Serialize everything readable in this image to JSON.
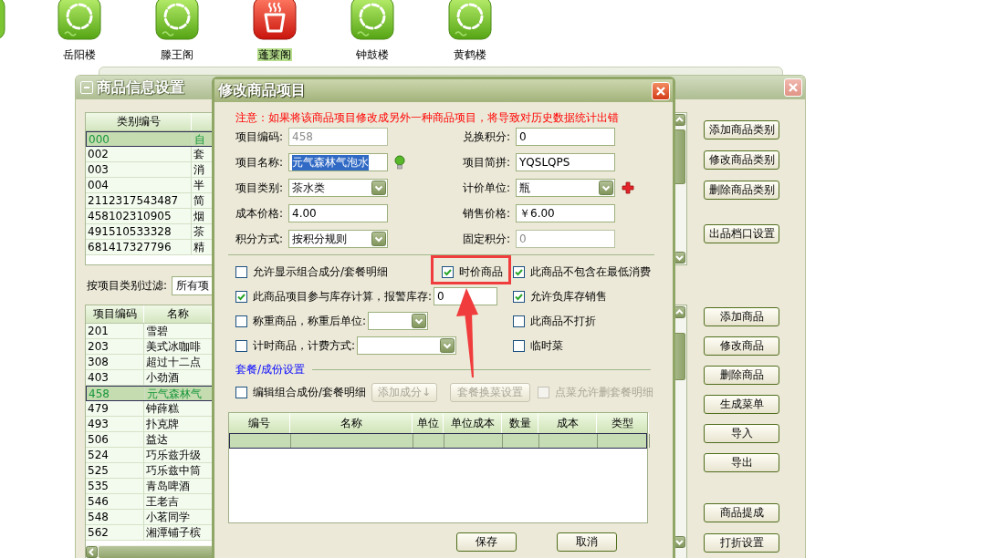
{
  "launcher": [
    {
      "label": "岳阳楼",
      "kind": "swirl",
      "selected": false
    },
    {
      "label": "滕王阁",
      "kind": "swirl",
      "selected": false
    },
    {
      "label": "蓬莱阁",
      "kind": "cup",
      "selected": true
    },
    {
      "label": "钟鼓楼",
      "kind": "swirl",
      "selected": false
    },
    {
      "label": "黄鹤楼",
      "kind": "swirl",
      "selected": false
    }
  ],
  "main_window": {
    "title": "商品信息设置",
    "category_table": {
      "columns": [
        "类别编号"
      ],
      "rows": [
        {
          "cells": [
            "000",
            "自"
          ],
          "selected": true
        },
        {
          "cells": [
            "002",
            "套"
          ],
          "selected": false
        },
        {
          "cells": [
            "003",
            "消"
          ],
          "selected": false
        },
        {
          "cells": [
            "004",
            "半"
          ],
          "selected": false
        },
        {
          "cells": [
            "2112317543487",
            "简"
          ],
          "selected": false
        },
        {
          "cells": [
            "458102310905",
            "烟"
          ],
          "selected": false
        },
        {
          "cells": [
            "491510533328",
            "茶"
          ],
          "selected": false
        },
        {
          "cells": [
            "681417327796",
            "精"
          ],
          "selected": false
        }
      ]
    },
    "filter": {
      "label": "按项目类别过滤:",
      "value": "所有项"
    },
    "item_table": {
      "columns": [
        "项目编码",
        "名称"
      ],
      "rows": [
        {
          "cells": [
            "201",
            "雪碧"
          ],
          "selected": false
        },
        {
          "cells": [
            "203",
            "美式冰咖啡"
          ],
          "selected": false
        },
        {
          "cells": [
            "308",
            "超过十二点"
          ],
          "selected": false
        },
        {
          "cells": [
            "403",
            "小劲酒"
          ],
          "selected": false
        },
        {
          "cells": [
            "458",
            "元气森林气"
          ],
          "selected": true
        },
        {
          "cells": [
            "479",
            "钟薛糕"
          ],
          "selected": false
        },
        {
          "cells": [
            "493",
            "扑克牌"
          ],
          "selected": false
        },
        {
          "cells": [
            "506",
            "益达"
          ],
          "selected": false
        },
        {
          "cells": [
            "524",
            "巧乐兹升级"
          ],
          "selected": false
        },
        {
          "cells": [
            "525",
            "巧乐兹中筒"
          ],
          "selected": false
        },
        {
          "cells": [
            "535",
            "青岛啤酒"
          ],
          "selected": false
        },
        {
          "cells": [
            "546",
            "王老吉"
          ],
          "selected": false
        },
        {
          "cells": [
            "548",
            "小茗同学"
          ],
          "selected": false
        },
        {
          "cells": [
            "562",
            "湘潭铺子槟"
          ],
          "selected": false
        }
      ]
    },
    "button_groups": [
      [
        "添加商品类别",
        "修改商品类别",
        "删除商品类别"
      ],
      [
        "出品档口设置"
      ],
      [
        "添加商品",
        "修改商品",
        "删除商品",
        "生成菜单",
        "导入",
        "导出"
      ],
      [
        "商品提成",
        "打折设置"
      ]
    ]
  },
  "dialog": {
    "title": "修改商品项目",
    "notice": "注意：如果将该商品项目修改成另外一种商品项目，将导致对历史数据统计出错",
    "fields": [
      {
        "label": "项目编码:",
        "value": "458",
        "kind": "text",
        "disabled": true,
        "highlighted": false,
        "bulb": false,
        "add_button": false
      },
      {
        "label": "兑换积分:",
        "value": "0",
        "kind": "text",
        "disabled": false,
        "highlighted": false,
        "bulb": false,
        "add_button": false
      },
      {
        "label": "项目名称:",
        "value": "元气森林气泡水",
        "kind": "text",
        "disabled": false,
        "highlighted": true,
        "bulb": true,
        "add_button": false
      },
      {
        "label": "项目简拼:",
        "value": "YQSLQPS",
        "kind": "text",
        "disabled": false,
        "highlighted": false,
        "bulb": false,
        "add_button": false
      },
      {
        "label": "项目类别:",
        "value": "茶水类",
        "kind": "combo",
        "disabled": false,
        "highlighted": false,
        "bulb": false,
        "add_button": false
      },
      {
        "label": "计价单位:",
        "value": "瓶",
        "kind": "combo",
        "disabled": false,
        "highlighted": false,
        "bulb": false,
        "add_button": true
      },
      {
        "label": "成本价格:",
        "value": "4.00",
        "kind": "text",
        "disabled": false,
        "highlighted": false,
        "bulb": false,
        "add_button": false
      },
      {
        "label": "销售价格:",
        "value": "￥6.00",
        "kind": "text",
        "disabled": false,
        "highlighted": false,
        "bulb": false,
        "add_button": false
      },
      {
        "label": "积分方式:",
        "value": "按积分规则",
        "kind": "combo",
        "disabled": false,
        "highlighted": false,
        "bulb": false,
        "add_button": false
      },
      {
        "label": "固定积分:",
        "value": "0",
        "kind": "text",
        "disabled": true,
        "highlighted": false,
        "bulb": false,
        "add_button": false
      }
    ],
    "options": [
      {
        "label": "允许显示组合成分/套餐明细",
        "kind": "check",
        "checked": false
      },
      {
        "label": "时价商品",
        "kind": "check",
        "checked": true
      },
      {
        "label": "此商品不包含在最低消费",
        "kind": "check",
        "checked": true
      },
      {
        "label": "此商品项目参与库存计算，报警库存:",
        "kind": "checkfield",
        "checked": true,
        "value": "0"
      },
      {
        "label": "允许负库存销售",
        "kind": "check",
        "checked": true
      },
      {
        "label": "称重商品，称重后单位:",
        "kind": "checkcombo",
        "checked": false
      },
      {
        "label": "此商品不打折",
        "kind": "check",
        "checked": false
      },
      {
        "label": "计时商品，计费方式:",
        "kind": "checkcombo",
        "checked": false
      },
      {
        "label": "临时菜",
        "kind": "check",
        "checked": false
      }
    ],
    "package": {
      "title": "套餐/成份设置",
      "edit_option": {
        "label": "编辑组合成份/套餐明细",
        "checked": false
      },
      "buttons": [
        {
          "label": "添加成分↓",
          "disabled": true
        },
        {
          "label": "套餐换菜设置",
          "disabled": true
        }
      ],
      "delete_option": {
        "label": "点菜允许删套餐明细",
        "checked": false,
        "disabled": true
      },
      "table": {
        "columns": [
          "编号",
          "名称",
          "单位",
          "单位成本",
          "数量",
          "成本",
          "类型"
        ],
        "rows": [
          {
            "selected": true
          }
        ]
      }
    },
    "buttons": [
      "保存",
      "取消"
    ]
  }
}
